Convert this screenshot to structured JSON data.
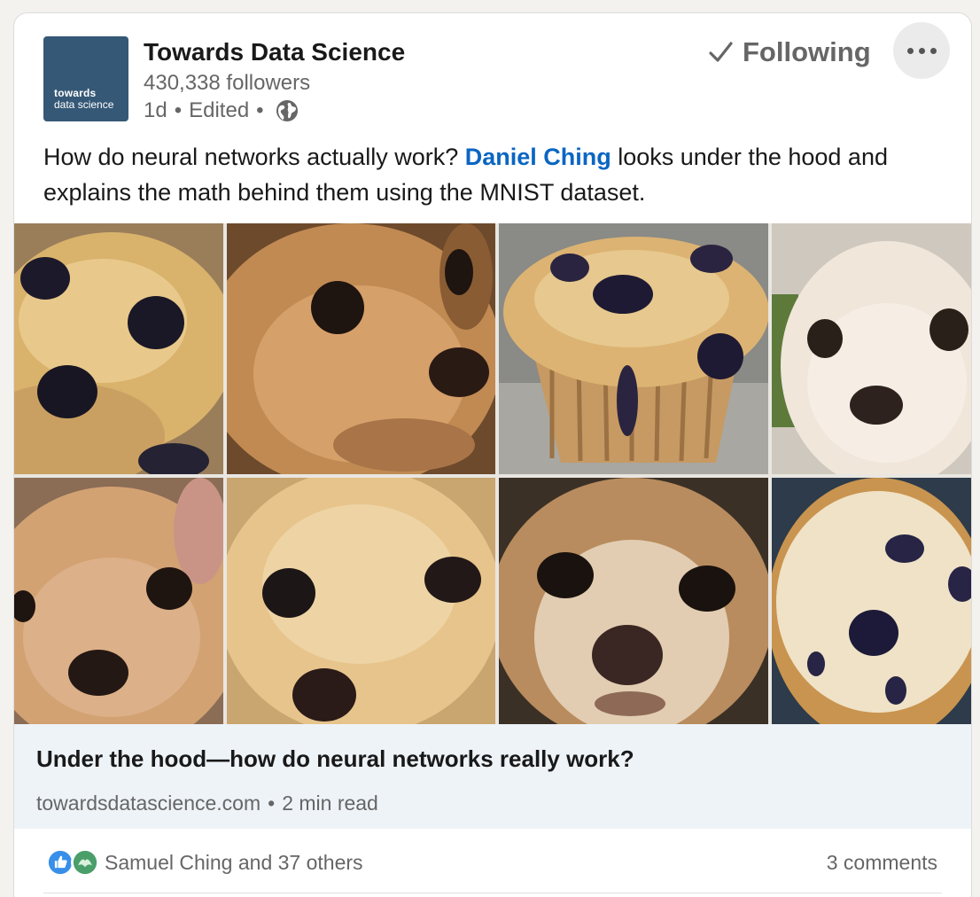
{
  "post": {
    "author": {
      "name": "Towards Data Science",
      "followers": "430,338 followers",
      "time": "1d",
      "edited": "Edited",
      "logo_line1": "towards",
      "logo_line2": "data science",
      "visibility_icon": "globe-icon"
    },
    "follow_label": "Following",
    "follow_icon": "check-icon",
    "more_icon": "more-options-icon",
    "text": {
      "before": "How do neural networks actually work? ",
      "mention": "Daniel Ching",
      "after": " looks under the hood and explains the math behind them using the MNIST dataset."
    },
    "image": {
      "tiles": [
        "muffin",
        "chihuahua",
        "muffin",
        "chihuahua",
        "chihuahua",
        "muffin",
        "chihuahua",
        "muffin"
      ]
    },
    "link_preview": {
      "title": "Under the hood—how do neural networks really work?",
      "domain": "towardsdatascience.com",
      "read_time": "2 min read"
    },
    "social": {
      "reaction_icons": [
        "like-icon",
        "support-icon"
      ],
      "reactions_text": "Samuel Ching and 37 others",
      "comments_text": "3 comments"
    }
  },
  "colors": {
    "accent": "#0a66c2",
    "logo_bg": "#355876",
    "preview_bg": "#eef3f8",
    "muted_text": "#666666"
  }
}
